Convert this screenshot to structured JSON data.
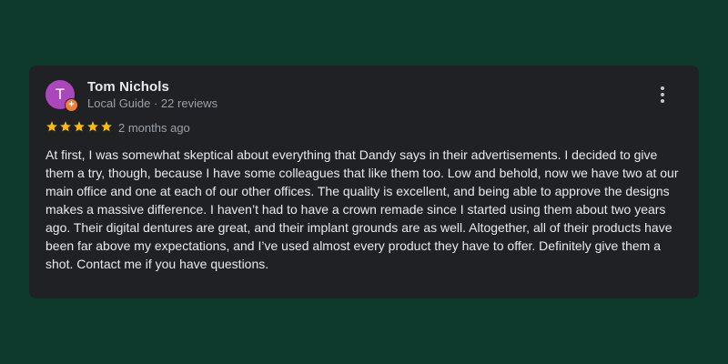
{
  "review": {
    "avatar_initial": "T",
    "avatar_color": "#ab47bc",
    "badge_color": "#f57c30",
    "badge_symbol": "+",
    "reviewer_name": "Tom Nichols",
    "reviewer_meta": "Local Guide · 22 reviews",
    "rating": 5,
    "rating_max": 5,
    "star_color": "#fbbc04",
    "date": "2 months ago",
    "text": "At first, I was somewhat skeptical about everything that Dandy says in their advertisements. I decided to give them a try, though, because I have some colleagues that like them too. Low and behold, now we have two at our main office and one at each of our other offices. The quality is excellent, and being able to approve the designs makes a massive difference. I haven’t had to have a crown remade since I started using them about two years ago. Their digital dentures are great, and their implant grounds are as well. Altogether, all of their products have been far above my expectations, and I’ve used almost every product they have to offer. Definitely give them a shot. Contact me if you have questions.",
    "more_icon": "more-vert-icon"
  }
}
